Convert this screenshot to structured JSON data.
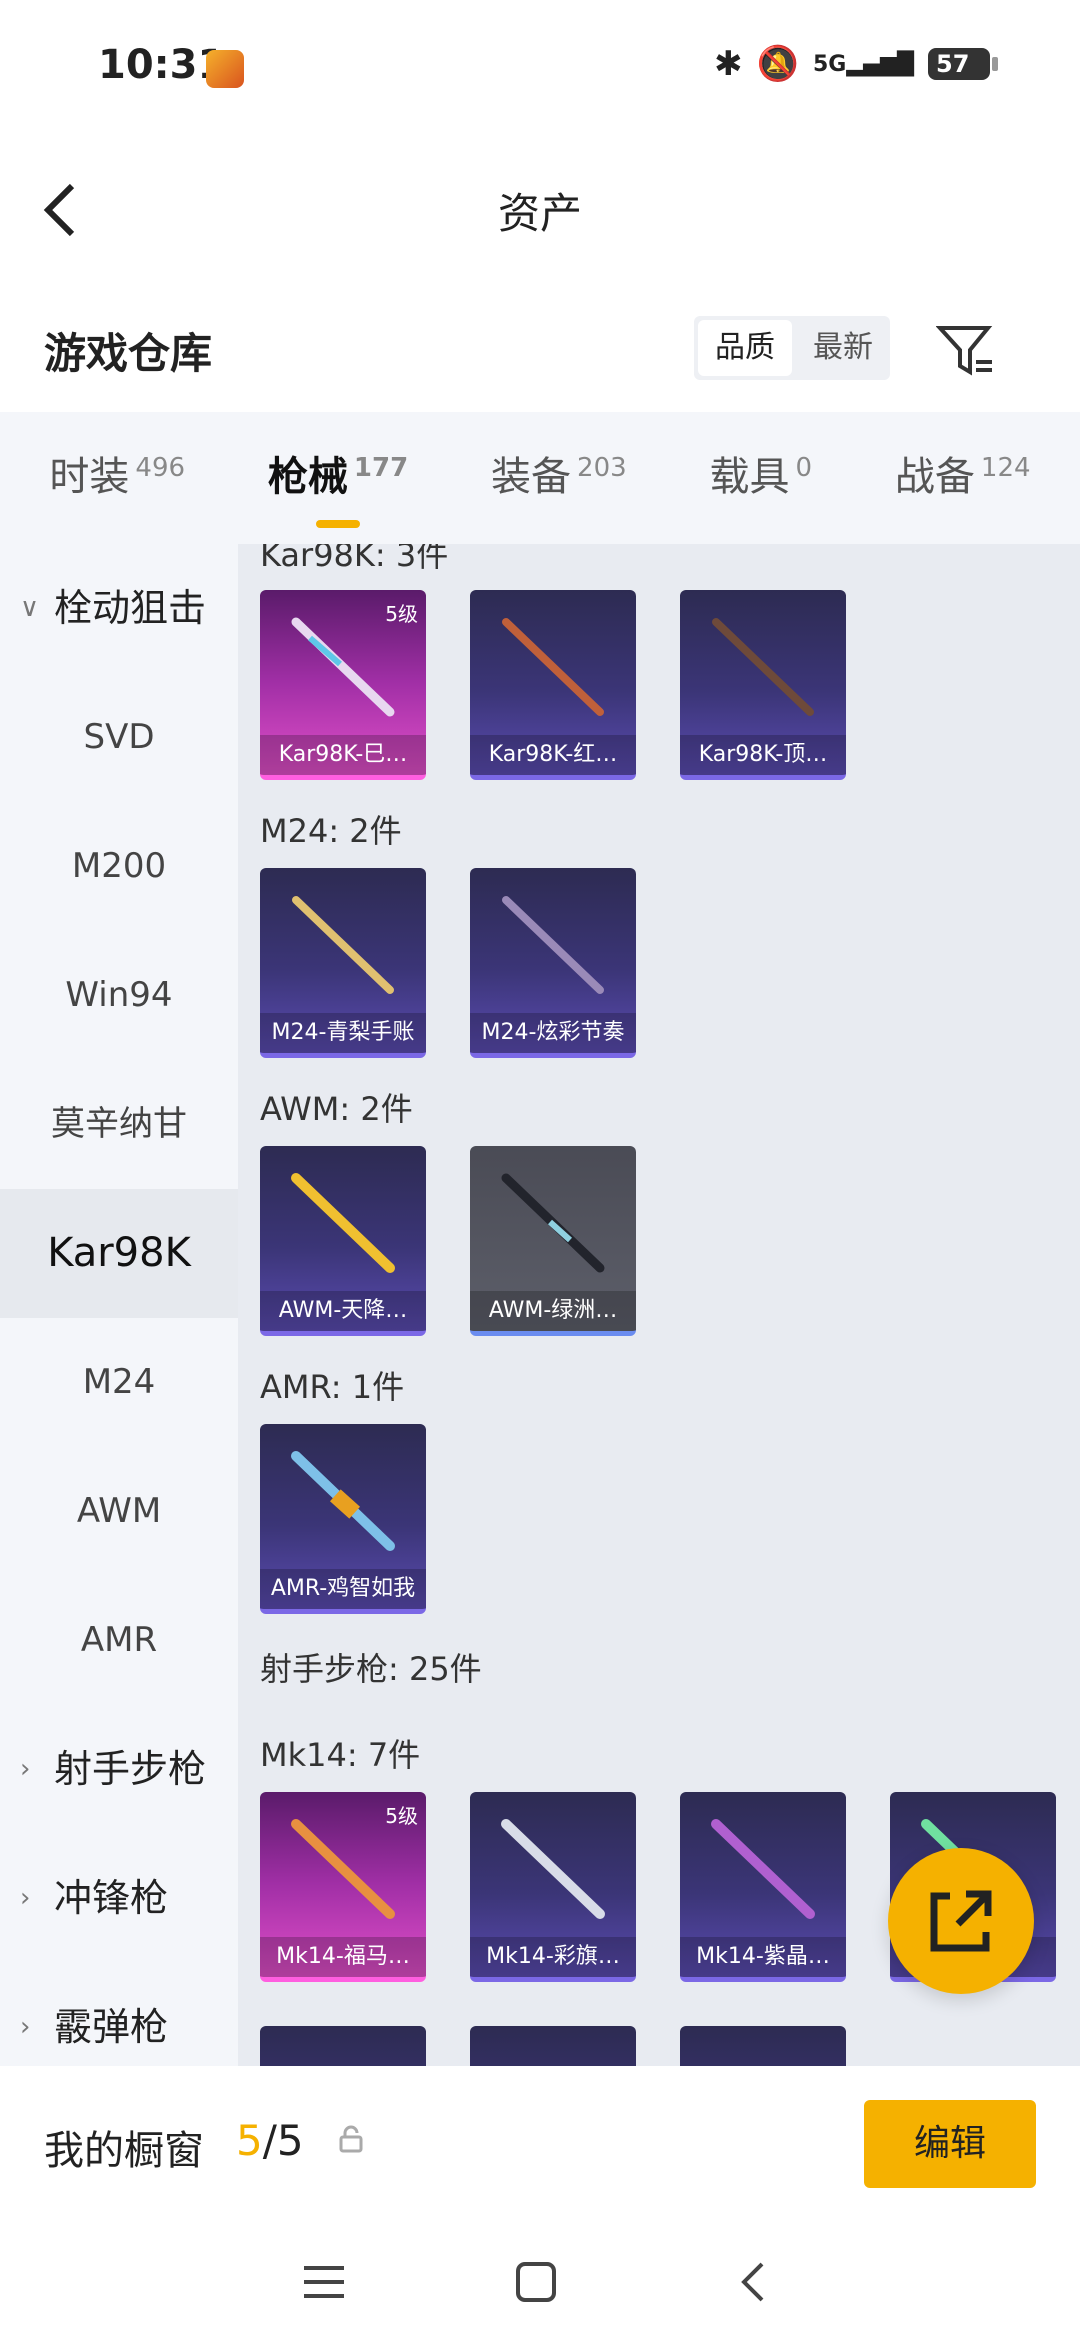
{
  "status": {
    "time": "10:31",
    "signal": "5G",
    "battery": "57"
  },
  "header": {
    "back_icon": "back-arrow",
    "title": "资产"
  },
  "warehouse": {
    "title": "游戏仓库",
    "sort_options": [
      "品质",
      "最新"
    ],
    "selected_sort": "品质"
  },
  "tabs": [
    {
      "label": "时装",
      "count": "496"
    },
    {
      "label": "枪械",
      "count": "177",
      "active": true
    },
    {
      "label": "装备",
      "count": "203"
    },
    {
      "label": "载具",
      "count": "0"
    },
    {
      "label": "战备",
      "count": "124"
    }
  ],
  "sidebar": {
    "group1": "栓动狙击",
    "items": [
      "SVD",
      "M200",
      "Win94",
      "莫辛纳甘",
      "Kar98K",
      "M24",
      "AWM",
      "AMR"
    ],
    "selected": "Kar98K",
    "group2": "射手步枪",
    "group3": "冲锋枪",
    "group4": "霰弹枪"
  },
  "sections": {
    "kar98k": {
      "header": "Kar98K: 3件",
      "cards": [
        {
          "label": "Kar98K-巳…",
          "level": "5级"
        },
        {
          "label": "Kar98K-红…"
        },
        {
          "label": "Kar98K-顶…"
        }
      ]
    },
    "m24": {
      "header": "M24: 2件",
      "cards": [
        {
          "label": "M24-青梨手账"
        },
        {
          "label": "M24-炫彩节奏"
        }
      ]
    },
    "awm": {
      "header": "AWM: 2件",
      "cards": [
        {
          "label": "AWM-天降…"
        },
        {
          "label": "AWM-绿洲…"
        }
      ]
    },
    "amr": {
      "header": "AMR: 1件",
      "cards": [
        {
          "label": "AMR-鸡智如我"
        }
      ]
    },
    "marksman": {
      "header": "射手步枪: 25件"
    },
    "mk14": {
      "header": "Mk14: 7件",
      "cards": [
        {
          "label": "Mk14-福马…",
          "level": "5级"
        },
        {
          "label": "Mk14-彩旗…"
        },
        {
          "label": "Mk14-紫晶…"
        },
        {
          "label": ""
        }
      ]
    }
  },
  "bottom": {
    "label": "我的橱窗",
    "current": "5",
    "total": "/5",
    "edit_label": "编辑"
  },
  "colors": {
    "accent": "#f5b100",
    "sidebar_bg": "#f4f6fa",
    "main_bg": "#e8ebf1"
  }
}
